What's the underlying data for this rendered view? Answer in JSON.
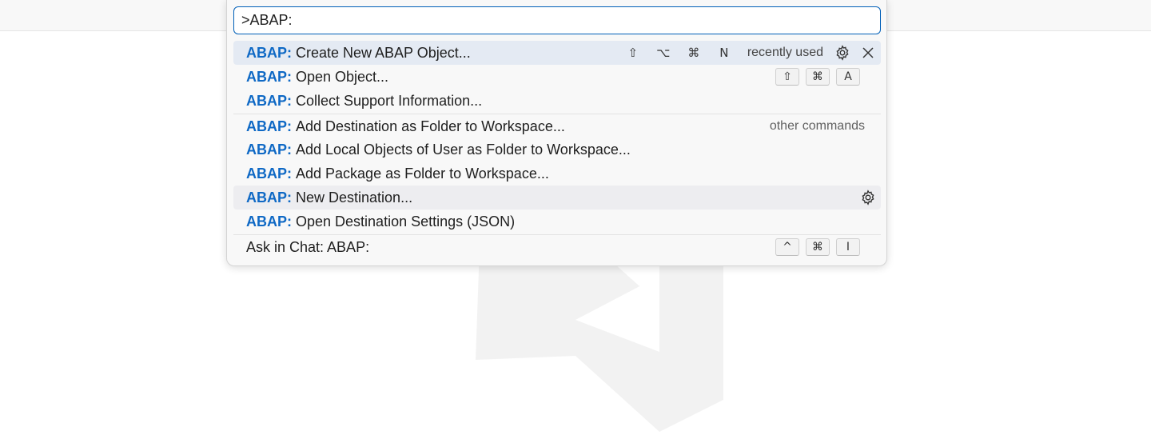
{
  "palette": {
    "input_value": ">ABAP:",
    "recently_used_label": "recently used",
    "other_commands_label": "other commands",
    "items": [
      {
        "prefix": "ABAP:",
        "text": "Create New ABAP Object...",
        "keys": [
          "⇧",
          "⌥",
          "⌘",
          "N"
        ]
      },
      {
        "prefix": "ABAP:",
        "text": "Open Object...",
        "keys": [
          "⇧",
          "⌘",
          "A"
        ]
      },
      {
        "prefix": "ABAP:",
        "text": "Collect Support Information..."
      },
      {
        "prefix": "ABAP:",
        "text": "Add Destination as Folder to Workspace..."
      },
      {
        "prefix": "ABAP:",
        "text": "Add Local Objects of User as Folder to Workspace..."
      },
      {
        "prefix": "ABAP:",
        "text": "Add Package as Folder to Workspace..."
      },
      {
        "prefix": "ABAP:",
        "text": "New Destination..."
      },
      {
        "prefix": "ABAP:",
        "text": "Open Destination Settings (JSON)"
      }
    ],
    "chat_item": {
      "text": "Ask in Chat: ABAP:",
      "keys": [
        "^",
        "⌘",
        "I"
      ]
    },
    "icons": [
      "gear-icon",
      "close-icon"
    ],
    "colors": {
      "accent": "#005fb8",
      "highlight": "#0f69c5",
      "selected_row": "#e4eaf3"
    }
  }
}
